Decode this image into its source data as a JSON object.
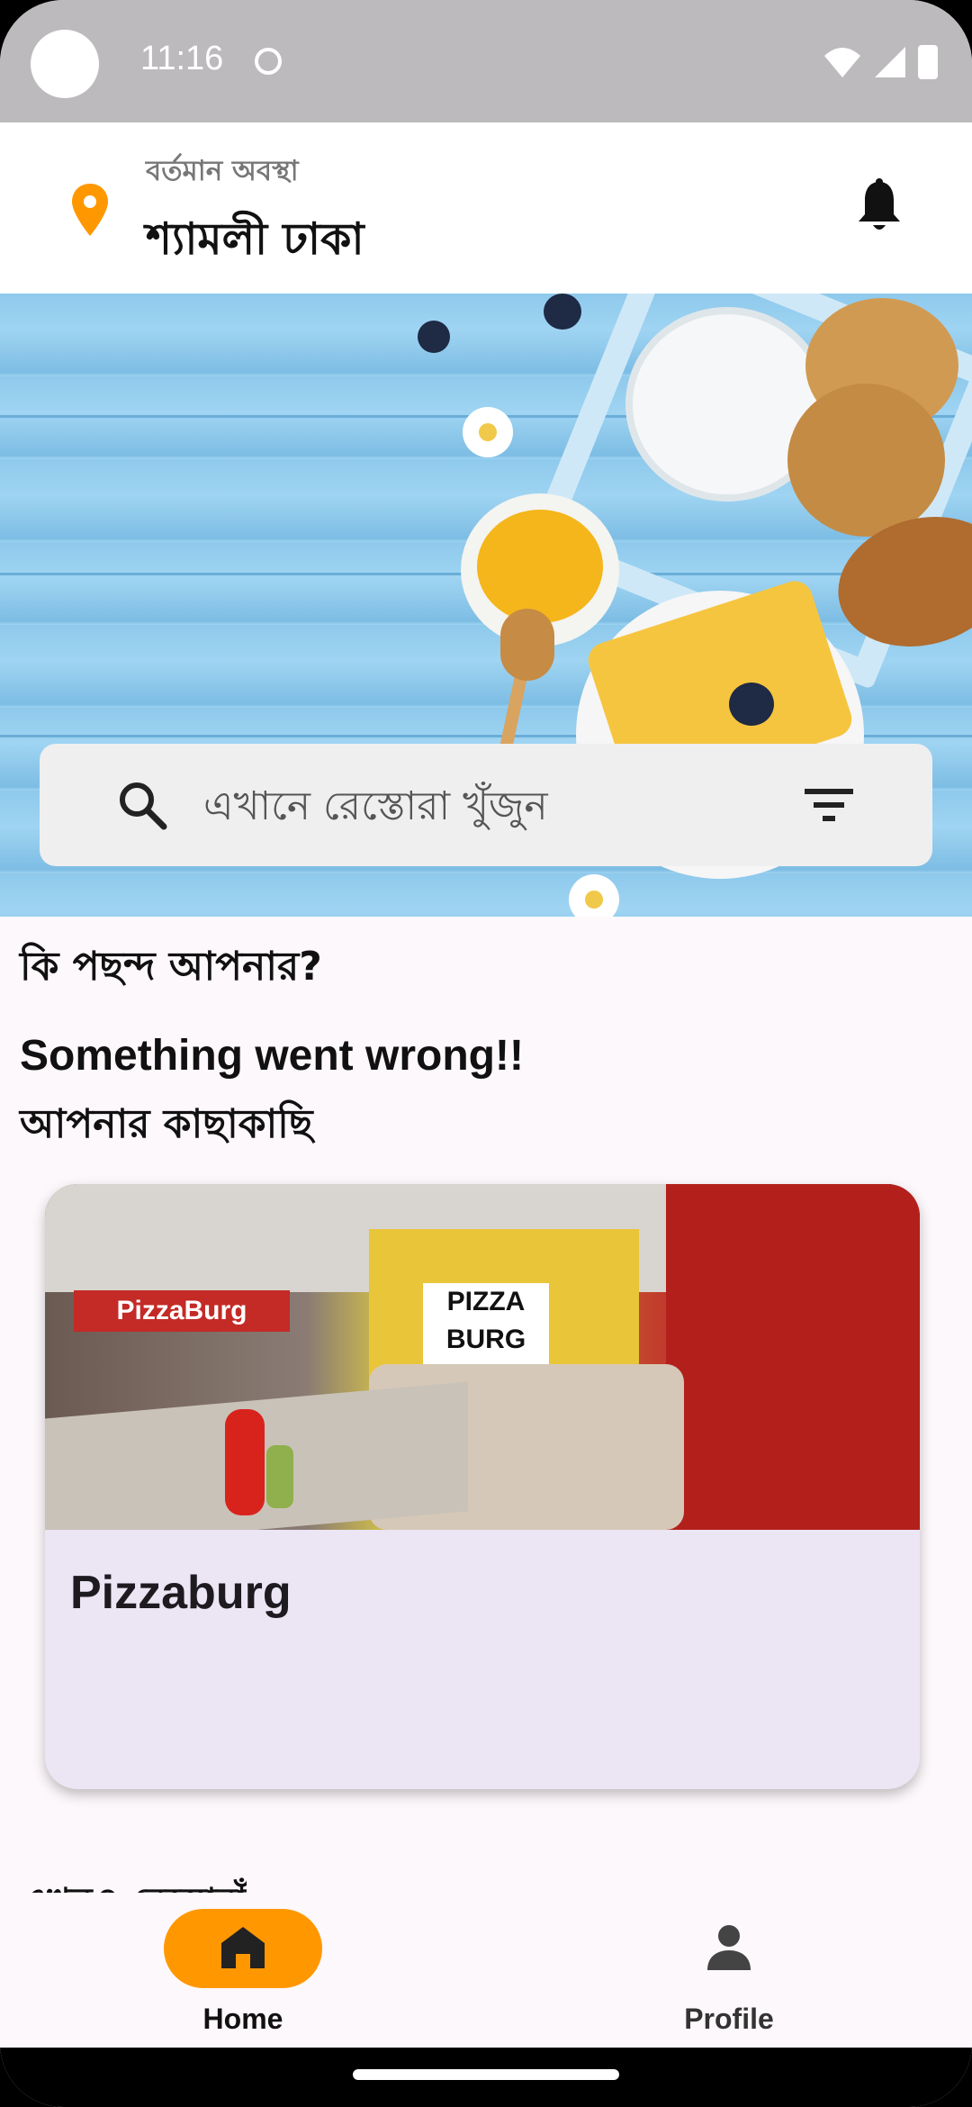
{
  "status_bar": {
    "time": "11:16"
  },
  "header": {
    "location_label": "বর্তমান অবস্থা",
    "location_value": "শ্যামলী ঢাকা"
  },
  "banner": {
    "brand_color": "#ff9800"
  },
  "search": {
    "placeholder": "এখানে রেস্তোরা খুঁজুন"
  },
  "sections": {
    "preference_title": "কি পছন্দ আপনার?",
    "error_message": "Something went wrong!!",
    "nearby_title": "আপনার কাছাকাছি",
    "next_section_partial": "এখনও রেস্তোরাঁ"
  },
  "restaurants": [
    {
      "name": "Pizzaburg",
      "sign_text": "PizzaBurg",
      "logo_text": "PIZZA BURG"
    }
  ],
  "bottom_nav": {
    "items": [
      {
        "label": "Home",
        "icon": "home-icon",
        "active": true
      },
      {
        "label": "Profile",
        "icon": "person-icon",
        "active": false
      }
    ]
  }
}
